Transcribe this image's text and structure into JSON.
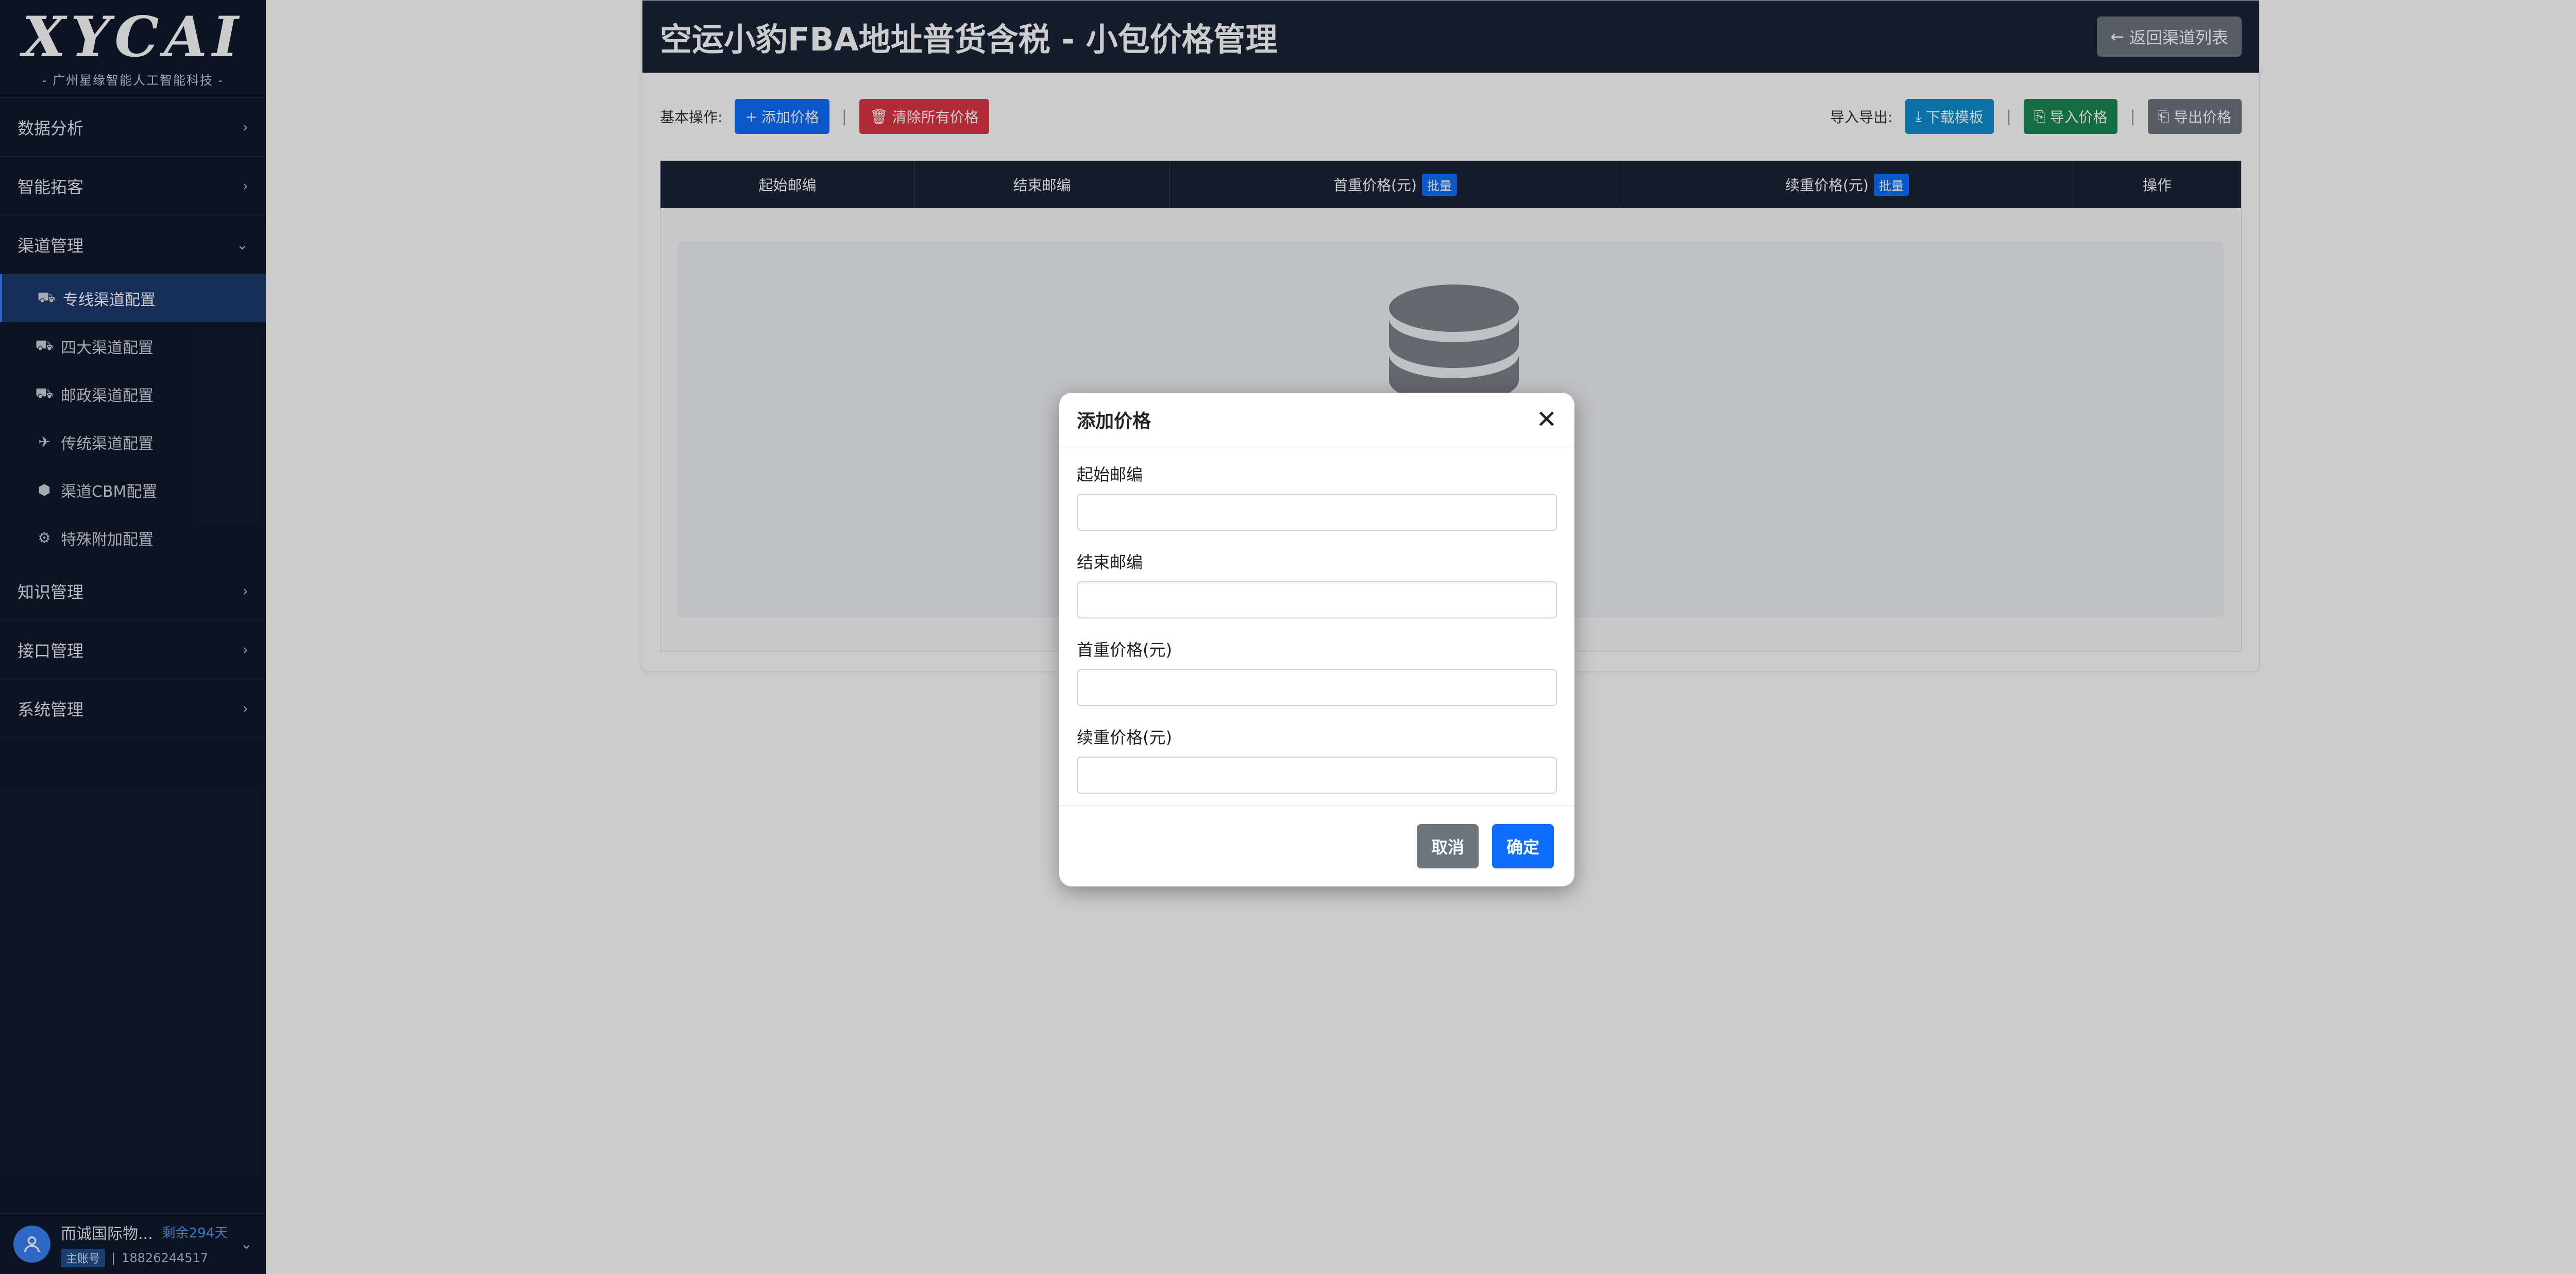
{
  "sidebar": {
    "logo": "XYCAI",
    "logo_sub": "- 广州星缘智能人工智能科技 -",
    "sections": [
      {
        "label": "数据分析",
        "chev": "›"
      },
      {
        "label": "智能拓客",
        "chev": "›"
      },
      {
        "label": "渠道管理",
        "chev": "⌄"
      }
    ],
    "sub_items": [
      {
        "label": "专线渠道配置",
        "icon": "truck-icon",
        "glyph": "⛟"
      },
      {
        "label": "四大渠道配置",
        "icon": "truck-icon",
        "glyph": "⛟"
      },
      {
        "label": "邮政渠道配置",
        "icon": "truck-icon",
        "glyph": "⛟"
      },
      {
        "label": "传统渠道配置",
        "icon": "plane-icon",
        "glyph": "✈"
      },
      {
        "label": "渠道CBM配置",
        "icon": "box-icon",
        "glyph": "⬢"
      },
      {
        "label": "特殊附加配置",
        "icon": "gear-icon",
        "glyph": "⚙"
      }
    ],
    "lower_sections": [
      {
        "label": "知识管理",
        "chev": "›"
      },
      {
        "label": "接口管理",
        "chev": "›"
      },
      {
        "label": "系统管理",
        "chev": "›"
      }
    ],
    "user": {
      "name": "而诚国际物...",
      "days": "剩余294天",
      "role": "主账号",
      "phone": "18826244517",
      "separator": "|"
    }
  },
  "page": {
    "title": "空运小豹FBA地址普货含税 - 小包价格管理",
    "back_label": "返回渠道列表",
    "toolbar": {
      "basic_label": "基本操作:",
      "add_label": "添加价格",
      "clear_label": "清除所有价格",
      "io_label": "导入导出:",
      "download_label": "下载模板",
      "import_label": "导入价格",
      "export_label": "导出价格",
      "sep": "|"
    },
    "table": {
      "columns": [
        {
          "label": "起始邮编",
          "badge": ""
        },
        {
          "label": "结束邮编",
          "badge": ""
        },
        {
          "label": "首重价格(元)",
          "badge": "批量"
        },
        {
          "label": "续重价格(元)",
          "badge": "批量"
        },
        {
          "label": "操作",
          "badge": ""
        }
      ]
    }
  },
  "modal": {
    "title": "添加价格",
    "close": "✕",
    "fields": [
      {
        "label": "起始邮编",
        "value": ""
      },
      {
        "label": "结束邮编",
        "value": ""
      },
      {
        "label": "首重价格(元)",
        "value": ""
      },
      {
        "label": "续重价格(元)",
        "value": ""
      }
    ],
    "cancel_label": "取消",
    "ok_label": "确定"
  },
  "colors": {
    "sidebar_bg": "#101a2e",
    "header_bg": "#1b2438",
    "primary": "#0d6efd",
    "danger": "#dc3545",
    "success": "#198754",
    "secondary": "#6c757d"
  }
}
